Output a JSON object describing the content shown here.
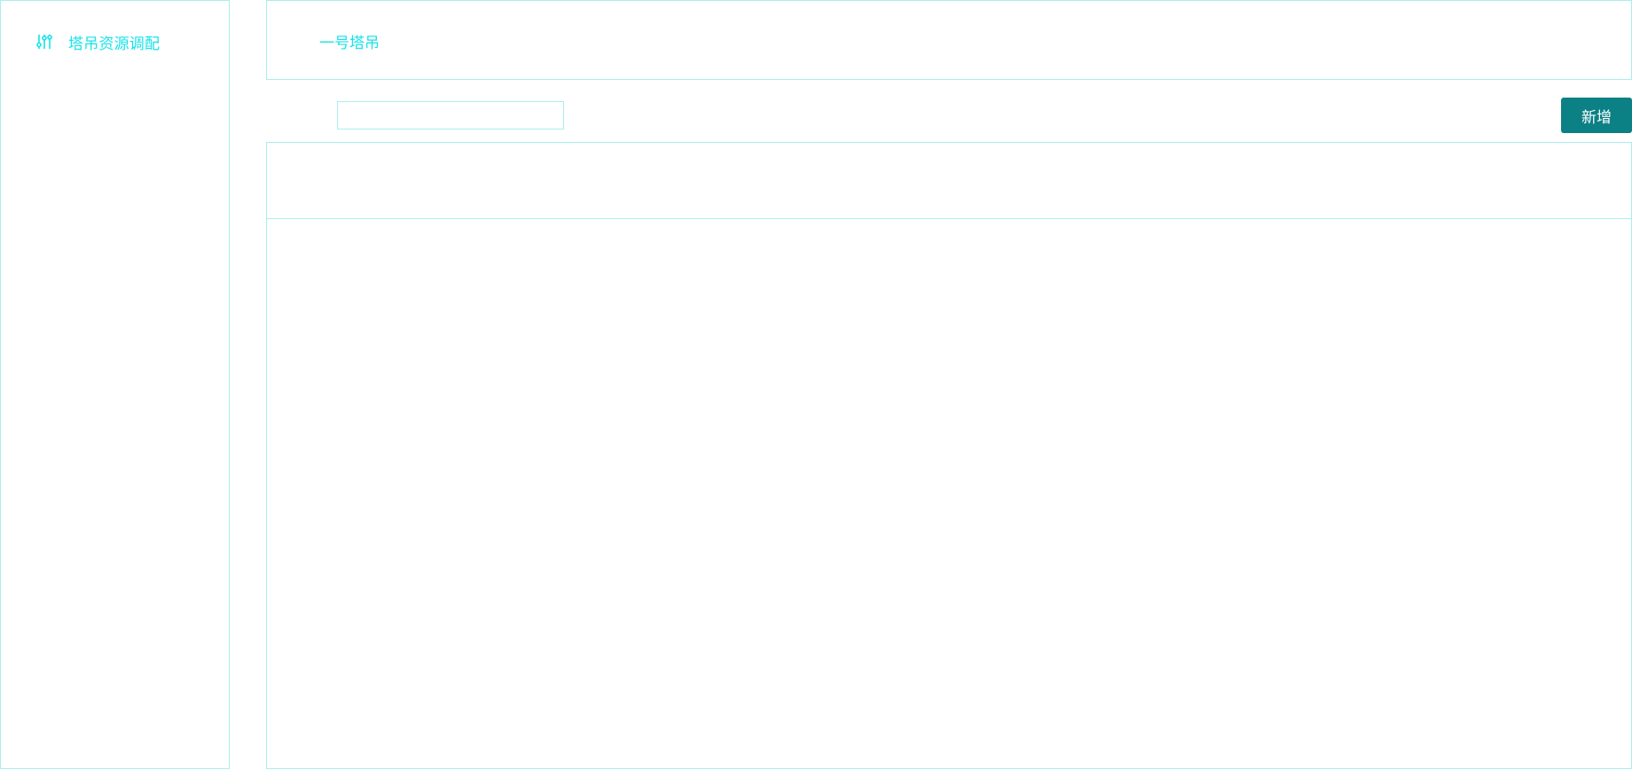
{
  "sidebar": {
    "items": [
      {
        "label": "塔吊资源调配",
        "icon": "sliders-icon"
      }
    ]
  },
  "header": {
    "title": "一号塔吊"
  },
  "toolbar": {
    "search_value": "",
    "search_placeholder": "",
    "add_label": "新增"
  },
  "colors": {
    "accent_text": "#16e3ea",
    "border": "#a8eef0",
    "button_bg": "#0b8085",
    "button_text": "#ffffff"
  }
}
